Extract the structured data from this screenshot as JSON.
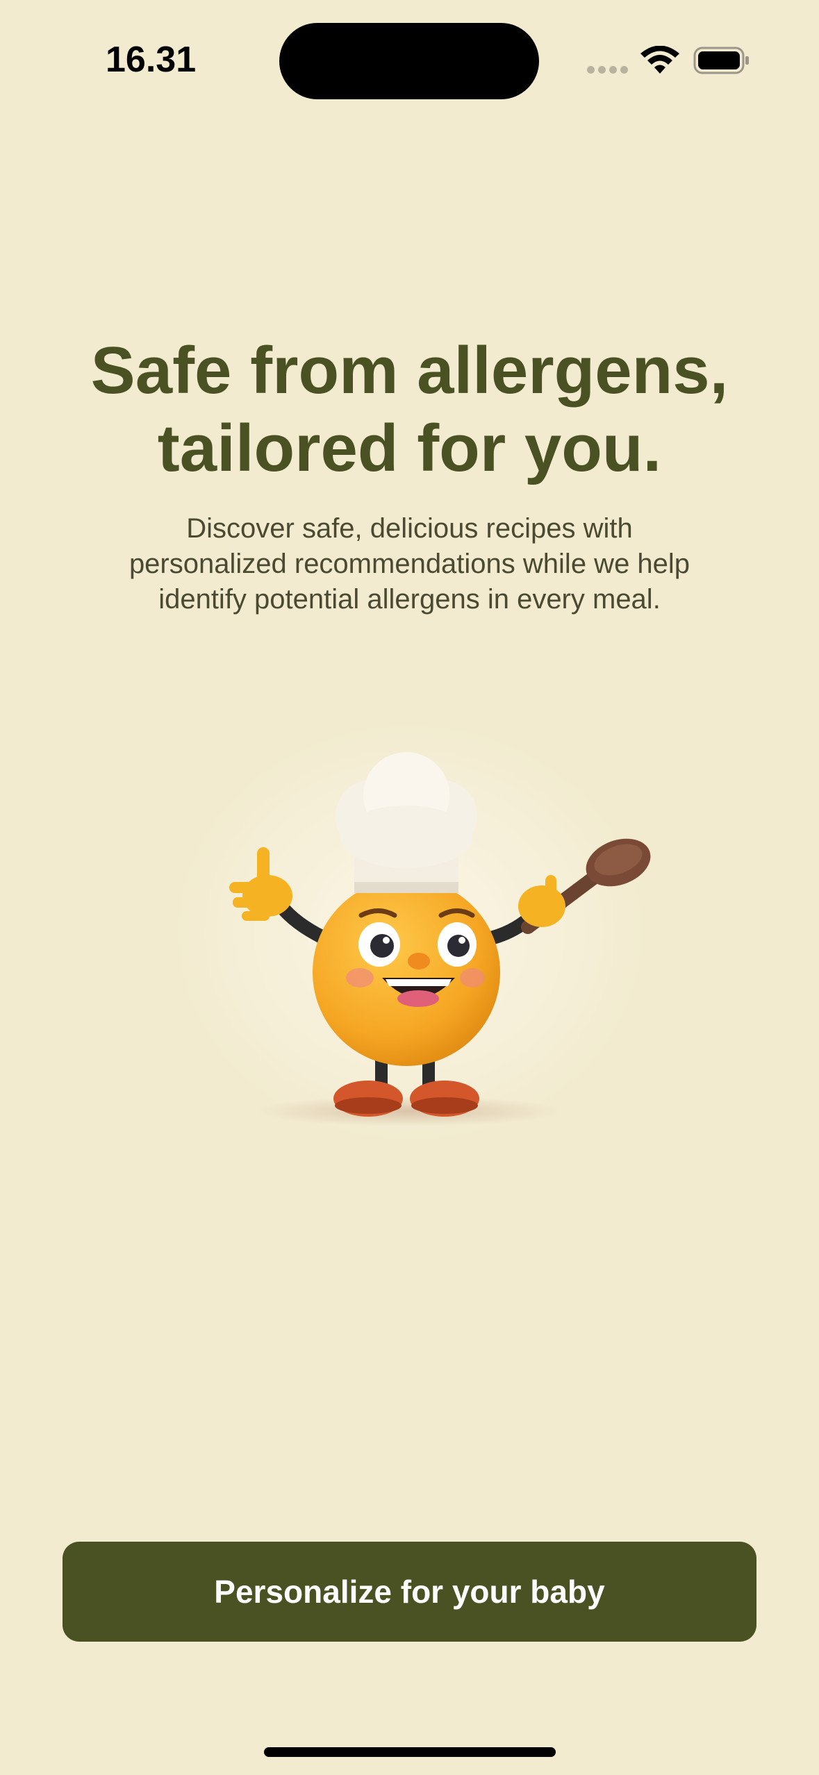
{
  "status_bar": {
    "time": "16.31",
    "icons": [
      "signal-icon",
      "wifi-icon",
      "battery-icon"
    ]
  },
  "onboarding": {
    "headline_line1": "Safe from allergens,",
    "headline_line2": "tailored for you.",
    "description_line1": "Discover safe, delicious recipes with",
    "description_line2": "personalized recommendations while we help",
    "description_line3": "identify potential allergens in every meal.",
    "illustration": "chef-mascot-illustration",
    "cta_label": "Personalize for your baby"
  },
  "colors": {
    "background": "#f2ebd0",
    "brand_olive": "#4a5223",
    "text_body": "#4a4a32",
    "button_text": "#ffffff"
  }
}
